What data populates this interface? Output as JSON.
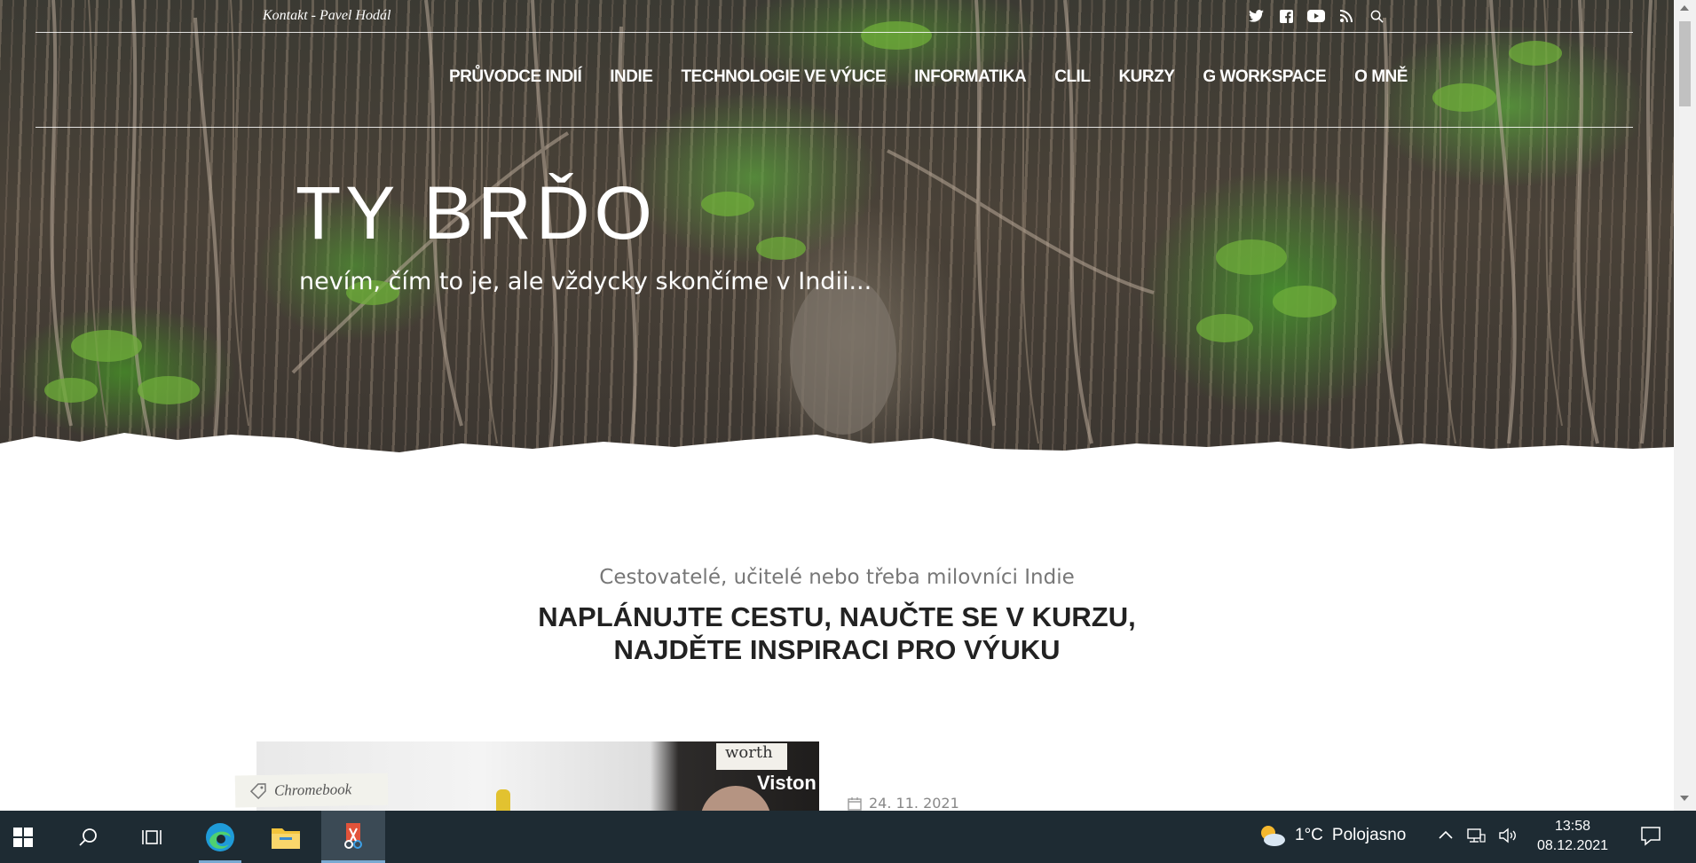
{
  "header": {
    "contact": "Kontakt - Pavel Hodál",
    "social_icons": [
      "twitter-icon",
      "facebook-icon",
      "youtube-icon",
      "rss-icon",
      "search-icon"
    ]
  },
  "nav": {
    "items": [
      {
        "label": "PRŮVODCE INDIÍ"
      },
      {
        "label": "INDIE"
      },
      {
        "label": "TECHNOLOGIE VE VÝUCE"
      },
      {
        "label": "INFORMATIKA"
      },
      {
        "label": "CLIL"
      },
      {
        "label": "KURZY"
      },
      {
        "label": "G WORKSPACE"
      },
      {
        "label": "O MNĚ"
      }
    ]
  },
  "hero": {
    "title": "TY BRĎO",
    "tagline": "nevím, čím to je, ale vždycky skončíme v Indii..."
  },
  "intro": {
    "subtitle": "Cestovatelé, učitelé nebo třeba milovníci Indie",
    "heading_line1": "NAPLÁNUJTE CESTU, NAUČTE SE V KURZU,",
    "heading_line2": "NAJDĚTE INSPIRACI PRO VÝUKU"
  },
  "post": {
    "tag": "Chromebook",
    "date": "24. 11. 2021",
    "image_sign_top": "worth",
    "image_sign_bottom": "Viston"
  },
  "taskbar": {
    "temperature": "1°C",
    "weather": "Polojasno",
    "time": "13:58",
    "date": "08.12.2021"
  },
  "colors": {
    "taskbar": "#1e2b33",
    "taskbar_active": "#3b4a55",
    "accent": "#78a9d1"
  }
}
